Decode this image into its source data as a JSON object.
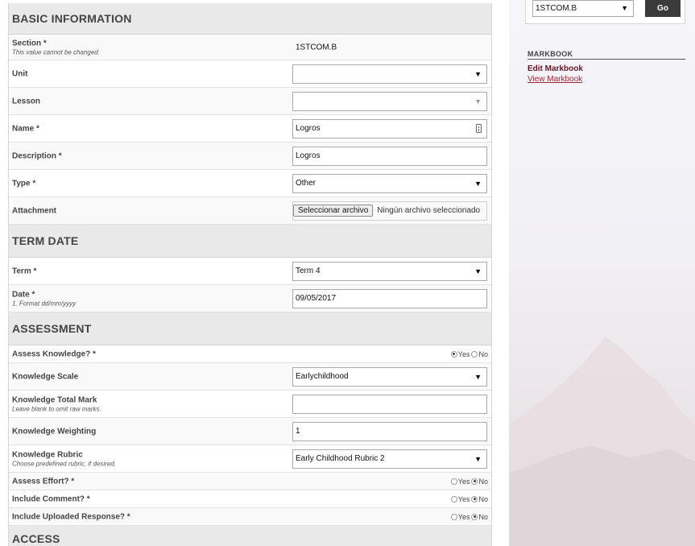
{
  "sections": {
    "basic": "BASIC INFORMATION",
    "term": "TERM DATE",
    "assessment": "ASSESSMENT",
    "access": "ACCESS"
  },
  "fields": {
    "section": {
      "label": "Section *",
      "sublabel": "This value cannot be changed.",
      "value": "1STCOM.B"
    },
    "unit": {
      "label": "Unit",
      "value": ""
    },
    "lesson": {
      "label": "Lesson",
      "value": ""
    },
    "name": {
      "label": "Name *",
      "value": "Logros"
    },
    "description": {
      "label": "Description *",
      "value": "Logros"
    },
    "type": {
      "label": "Type *",
      "value": "Other"
    },
    "attachment": {
      "label": "Attachment",
      "button": "Seleccionar archivo",
      "status": "Ningún archivo seleccionado"
    },
    "term": {
      "label": "Term *",
      "value": "Term 4"
    },
    "date": {
      "label": "Date *",
      "sublabel": "1. Format dd/mm/yyyy",
      "value": "09/05/2017"
    },
    "assess_knowledge": {
      "label": "Assess Knowledge? *",
      "yes": "Yes",
      "no": "No",
      "selected": "yes"
    },
    "knowledge_scale": {
      "label": "Knowledge Scale",
      "value": "Earlychildhood"
    },
    "knowledge_total": {
      "label": "Knowledge Total Mark",
      "sublabel": "Leave blank to omit raw marks.",
      "value": ""
    },
    "knowledge_weighting": {
      "label": "Knowledge Weighting",
      "value": "1"
    },
    "knowledge_rubric": {
      "label": "Knowledge Rubric",
      "sublabel": "Choose predefined rubric, if desired.",
      "value": "Early Childhood Rubric 2"
    },
    "assess_effort": {
      "label": "Assess Effort? *",
      "yes": "Yes",
      "no": "No",
      "selected": "no"
    },
    "include_comment": {
      "label": "Include Comment? *",
      "yes": "Yes",
      "no": "No",
      "selected": "no"
    },
    "include_uploaded": {
      "label": "Include Uploaded Response? *",
      "yes": "Yes",
      "no": "No",
      "selected": "no"
    }
  },
  "sidebar": {
    "select_value": "1STCOM.B",
    "go_label": "Go",
    "markbook_heading": "MARKBOOK",
    "edit_link": "Edit Markbook",
    "view_link": "View Markbook"
  },
  "icons": {
    "select_arrow": "▼"
  }
}
